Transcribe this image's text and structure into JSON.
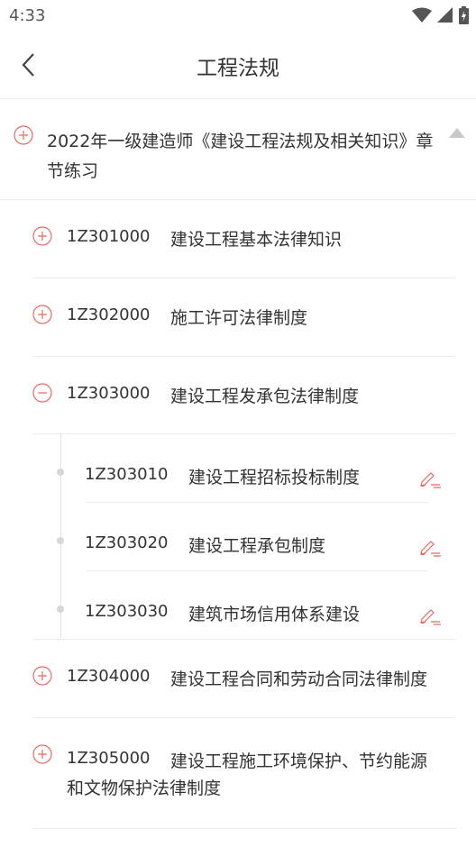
{
  "status": {
    "time": "4:33"
  },
  "header": {
    "title": "工程法规"
  },
  "chapter": {
    "title": "2022年一级建造师《建设工程法规及相关知识》章节练习"
  },
  "sections": [
    {
      "code": "1Z301000",
      "title": "建设工程基本法律知识",
      "state": "collapsed"
    },
    {
      "code": "1Z302000",
      "title": "施工许可法律制度",
      "state": "collapsed"
    },
    {
      "code": "1Z303000",
      "title": "建设工程发承包法律制度",
      "state": "expanded"
    },
    {
      "code": "1Z304000",
      "title": "建设工程合同和劳动合同法律制度",
      "state": "collapsed"
    },
    {
      "code": "1Z305000",
      "title": "建设工程施工环境保护、节约能源和文物保护法律制度",
      "line1": "建设工程施工环境保护、节约能源",
      "line2": "和文物保护法律制度",
      "state": "collapsed"
    }
  ],
  "subsections": [
    {
      "code": "1Z303010",
      "title": "建设工程招标投标制度"
    },
    {
      "code": "1Z303020",
      "title": "建设工程承包制度"
    },
    {
      "code": "1Z303030",
      "title": "建筑市场信用体系建设"
    }
  ],
  "colors": {
    "accent": "#e9685f",
    "divider": "#ececec",
    "text": "#333333"
  },
  "icons": {
    "expand": "plus-circle-icon",
    "collapse": "minus-circle-icon",
    "practice": "pen-icon",
    "back": "chevron-left-icon"
  }
}
